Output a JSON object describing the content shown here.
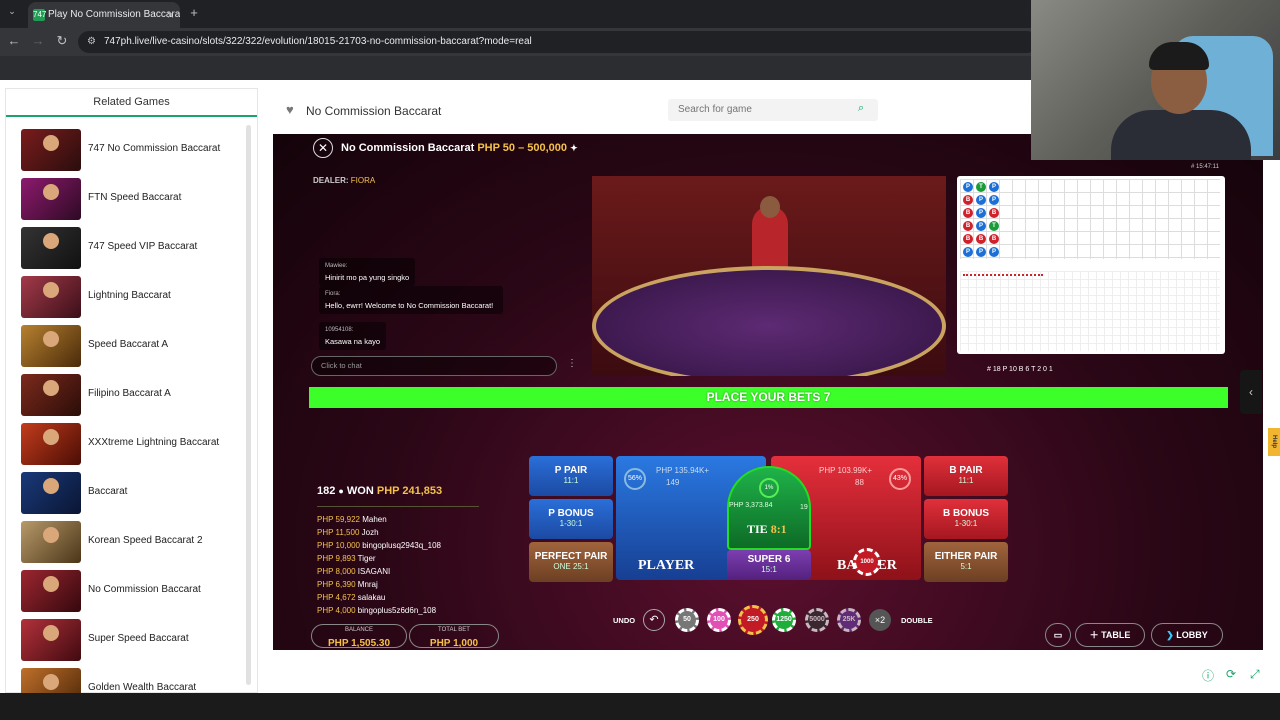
{
  "browser": {
    "tab_title": "Play No Commission Baccarat",
    "tab_favicon": "747",
    "url": "747ph.live/live-casino/slots/322/322/evolution/18015-21703-no-commission-baccarat?mode=real",
    "new_tab": "+",
    "close_tab": "×"
  },
  "sidebar": {
    "title": "Related Games",
    "games": [
      {
        "label": "747 No Commission Baccarat"
      },
      {
        "label": "FTN Speed Baccarat"
      },
      {
        "label": "747 Speed VIP Baccarat"
      },
      {
        "label": "Lightning Baccarat"
      },
      {
        "label": "Speed Baccarat A"
      },
      {
        "label": "Filipino Baccarat A"
      },
      {
        "label": "XXXtreme Lightning Baccarat"
      },
      {
        "label": "Baccarat"
      },
      {
        "label": "Korean Speed Baccarat 2"
      },
      {
        "label": "No Commission Baccarat"
      },
      {
        "label": "Super Speed Baccarat"
      },
      {
        "label": "Golden Wealth Baccarat"
      }
    ]
  },
  "header": {
    "title": "No Commission Baccarat",
    "search_placeholder": "Search for game"
  },
  "game": {
    "title": "No Commission Baccarat",
    "limits": "PHP 50 – 500,000",
    "dealer_label": "DEALER:",
    "dealer_name": "FIORA",
    "chat": [
      {
        "who": "Mawiee:",
        "text": "Hinirit mo pa yung singko"
      },
      {
        "who": "Fiora:",
        "text": "Hello, ewrr! Welcome to No Commission Baccarat!"
      },
      {
        "who": "10954108:",
        "text": "Kasawa na kayo"
      }
    ],
    "chat_placeholder": "Click to chat",
    "stats": "# 18   P 10   B 6   T 2   0   1",
    "place_bets": "PLACE YOUR BETS 7",
    "players_count": "182",
    "won_label": "WON",
    "won_amount": "PHP 241,853",
    "winners": [
      {
        "amount": "PHP 59,922",
        "name": "Mahen"
      },
      {
        "amount": "PHP 11,500",
        "name": "Jozh"
      },
      {
        "amount": "PHP 10,000",
        "name": "bingoplusq2943q_108"
      },
      {
        "amount": "PHP 9,893",
        "name": "Tiger"
      },
      {
        "amount": "PHP 8,000",
        "name": "ISAGANI"
      },
      {
        "amount": "PHP 6,390",
        "name": "Mnraj"
      },
      {
        "amount": "PHP 4,672",
        "name": "salakau"
      },
      {
        "amount": "PHP 4,000",
        "name": "bingoplus5z6d6n_108"
      }
    ],
    "balance_label": "BALANCE",
    "balance": "PHP 1,505.30",
    "total_bet_label": "TOTAL BET",
    "total_bet": "PHP 1,000",
    "bets": {
      "p_pair": {
        "name": "P PAIR",
        "odds": "11:1"
      },
      "p_bonus": {
        "name": "P BONUS",
        "odds": "1-30:1"
      },
      "perfect_pair": {
        "name": "PERFECT PAIR",
        "odds": "ONE 25:1"
      },
      "b_pair": {
        "name": "B PAIR",
        "odds": "11:1"
      },
      "b_bonus": {
        "name": "B BONUS",
        "odds": "1-30:1"
      },
      "either_pair": {
        "name": "EITHER PAIR",
        "odds": "5:1"
      },
      "player": {
        "name": "PLAYER",
        "pct": "56%",
        "total": "PHP 135.94K+",
        "count": "149"
      },
      "banker": {
        "name": "BANKER",
        "pct": "43%",
        "total": "PHP 103.99K+",
        "count": "88"
      },
      "tie": {
        "name": "TIE",
        "odds": "8:1",
        "pct": "1%",
        "total": "PHP 3,373.84",
        "count": "19"
      },
      "super6": {
        "name": "SUPER 6",
        "odds": "15:1"
      }
    },
    "undo": "UNDO",
    "double": "DOUBLE",
    "x2": "×2",
    "chips": [
      "50",
      "100",
      "250",
      "1250",
      "5000",
      "25K"
    ],
    "table_btn": "TABLE",
    "lobby_btn": "LOBBY",
    "timestamp": "# 15:47:11"
  },
  "help": "Help",
  "colors": {
    "accent": "#1aa36b",
    "bets_bar": "#3cff2a",
    "gold": "#f4c14a"
  }
}
